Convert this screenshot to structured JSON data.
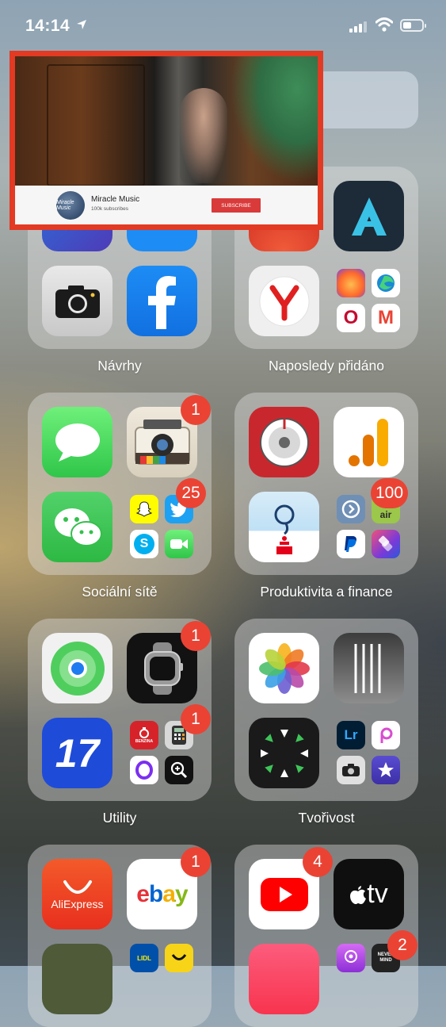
{
  "status_bar": {
    "time": "14:14"
  },
  "pip": {
    "channel_logo_text": "Miracle Music",
    "channel_name": "Miracle Music",
    "subscribers": "100k subscribes",
    "subscribe_label": "SUBSCRIBE"
  },
  "folders": {
    "suggestions": {
      "label": "Návrhy",
      "apps": {
        "camera": "camera",
        "facebook": "Facebook"
      }
    },
    "recently_added": {
      "label": "Naposledy přidáno",
      "apps": {
        "yandex": "Yandex",
        "gmail": "M",
        "opera": "O"
      }
    },
    "social": {
      "label": "Sociální sítě",
      "badges": {
        "instant_camera": "1",
        "twitter": "25"
      },
      "apps": {
        "skype": "S"
      }
    },
    "productivity": {
      "label": "Produktivita a finance",
      "badges": {
        "mini_group": "100"
      },
      "apps": {
        "air_label": "air"
      }
    },
    "utilities": {
      "label": "Utility",
      "badges": {
        "watch": "1",
        "calculator": "1"
      },
      "apps": {
        "app17": "17",
        "benzina": "BENZINA"
      }
    },
    "creativity": {
      "label": "Tvořivost",
      "apps": {
        "lightroom": "Lr"
      }
    },
    "shopping": {
      "badges": {
        "ebay": "1"
      },
      "apps": {
        "aliexpress": "AliExpress",
        "ebay": "ebay",
        "lidl": "LIDL"
      }
    },
    "entertainment": {
      "badges": {
        "youtube": "4",
        "nevermind": "2"
      },
      "apps": {
        "appletv": "tv",
        "nevermind": "NEVER MIND"
      }
    }
  },
  "colors": {
    "badge": "#ea4334",
    "pip_border": "#e23a23",
    "subscribe": "#d93a3a"
  }
}
